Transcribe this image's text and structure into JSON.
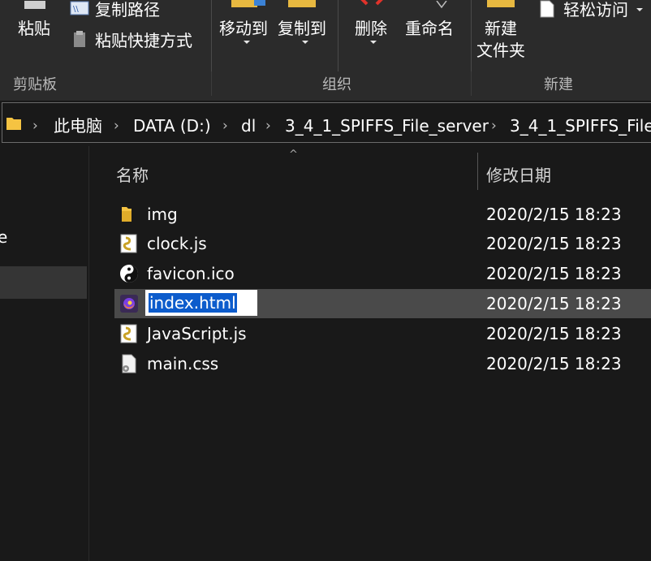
{
  "ribbon": {
    "clipboard": {
      "paste_label": "粘贴",
      "copy_path_label": "复制路径",
      "paste_shortcut_label": "粘贴快捷方式",
      "group_label": "剪贴板"
    },
    "organize": {
      "move_to_label": "移动到",
      "copy_to_label": "复制到",
      "delete_label": "删除",
      "rename_label": "重命名",
      "group_label": "组织"
    },
    "new": {
      "new_folder_line1": "新建",
      "new_folder_line2": "文件夹",
      "easy_access_label": "轻松访问",
      "group_label": "新建"
    }
  },
  "addressbar": {
    "crumbs": [
      "此电脑",
      "DATA (D:)",
      "dl",
      "3_4_1_SPIFFS_File_server",
      "3_4_1_SPIFFS_File_"
    ]
  },
  "nav": {
    "partial_label": "e"
  },
  "columns": {
    "name": "名称",
    "modified": "修改日期"
  },
  "files": [
    {
      "name": "img",
      "date": "2020/2/15 18:23",
      "icon": "folder-icon"
    },
    {
      "name": "clock.js",
      "date": "2020/2/15 18:23",
      "icon": "js-script-icon"
    },
    {
      "name": "favicon.ico",
      "date": "2020/2/15 18:23",
      "icon": "ico-image-icon"
    },
    {
      "name": "index.html",
      "date": "2020/2/15 18:23",
      "icon": "firefox-html-icon",
      "selected": true,
      "renaming": true
    },
    {
      "name": "JavaScript.js",
      "date": "2020/2/15 18:23",
      "icon": "js-script-icon"
    },
    {
      "name": "main.css",
      "date": "2020/2/15 18:23",
      "icon": "css-file-icon"
    }
  ],
  "colors": {
    "background": "#191919",
    "ribbon": "#2b2b2b",
    "selection_row": "#4a4a4a",
    "text_selection": "#0d5ccc",
    "folder": "#f5c342"
  }
}
